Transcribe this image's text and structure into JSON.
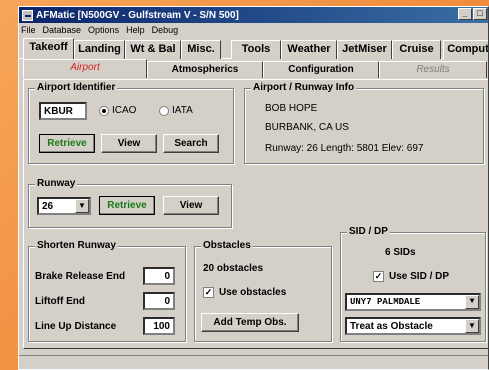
{
  "window": {
    "title": "AFMatic [N500GV - Gulfstream V - S/N 500]",
    "minimize": "_",
    "restore": "□"
  },
  "menu": [
    "File",
    "Database",
    "Options",
    "Help",
    "Debug"
  ],
  "main_tabs": [
    {
      "label": "Takeoff"
    },
    {
      "label": "Landing"
    },
    {
      "label": "Wt & Bal"
    },
    {
      "label": "Misc."
    },
    {
      "label": "Tools"
    },
    {
      "label": "Weather"
    },
    {
      "label": "JetMiser"
    },
    {
      "label": "Cruise"
    },
    {
      "label": "Comput"
    }
  ],
  "sub_tabs": [
    {
      "label": "Airport"
    },
    {
      "label": "Atmospherics"
    },
    {
      "label": "Configuration"
    },
    {
      "label": "Results"
    }
  ],
  "airport_identifier": {
    "title": "Airport Identifier",
    "value": "KBUR",
    "icao_label": "ICAO",
    "iata_label": "IATA",
    "selected": "ICAO",
    "retrieve": "Retrieve",
    "view": "View",
    "search": "Search"
  },
  "airport_info": {
    "title": "Airport / Runway Info",
    "name": "BOB HOPE",
    "city": "BURBANK, CA US",
    "details": "Runway: 26   Length: 5801   Elev: 697"
  },
  "runway": {
    "title": "Runway",
    "value": "26",
    "retrieve": "Retrieve",
    "view": "View"
  },
  "shorten_runway": {
    "title": "Shorten Runway",
    "brake_release_label": "Brake Release End",
    "brake_release_value": "0",
    "liftoff_label": "Liftoff End",
    "liftoff_value": "0",
    "lineup_label": "Line Up Distance",
    "lineup_value": "100"
  },
  "obstacles": {
    "title": "Obstacles",
    "count": "20 obstacles",
    "use_label": "Use obstacles",
    "use_checked": true,
    "add_button": "Add Temp Obs."
  },
  "sid": {
    "title": "SID / DP",
    "count": "6 SIDs",
    "use_label": "Use SID / DP",
    "use_checked": true,
    "selected": "UNY7    PALMDALE",
    "mode": "Treat as Obstacle"
  }
}
